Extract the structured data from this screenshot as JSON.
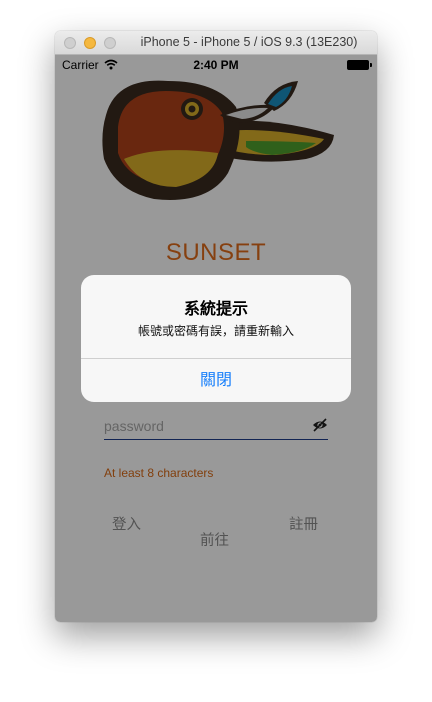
{
  "window": {
    "title": "iPhone 5 - iPhone 5 / iOS 9.3 (13E230)"
  },
  "status_bar": {
    "carrier": "Carrier",
    "time": "2:40 PM"
  },
  "app": {
    "title": "SUNSET",
    "password": {
      "placeholder": "password",
      "value": "",
      "hint": "At least 8 characters"
    },
    "buttons": {
      "login": "登入",
      "register": "註冊",
      "go": "前往"
    }
  },
  "alert": {
    "title": "系統提示",
    "message": "帳號或密碼有誤，請重新輸入",
    "button": "關閉"
  },
  "colors": {
    "accent_orange": "#e06c1b",
    "alert_button_blue": "#157efb",
    "field_underline": "#1f3c8a"
  },
  "icons": [
    "wifi-icon",
    "battery-icon",
    "bird-logo",
    "eye-toggle-icon"
  ]
}
